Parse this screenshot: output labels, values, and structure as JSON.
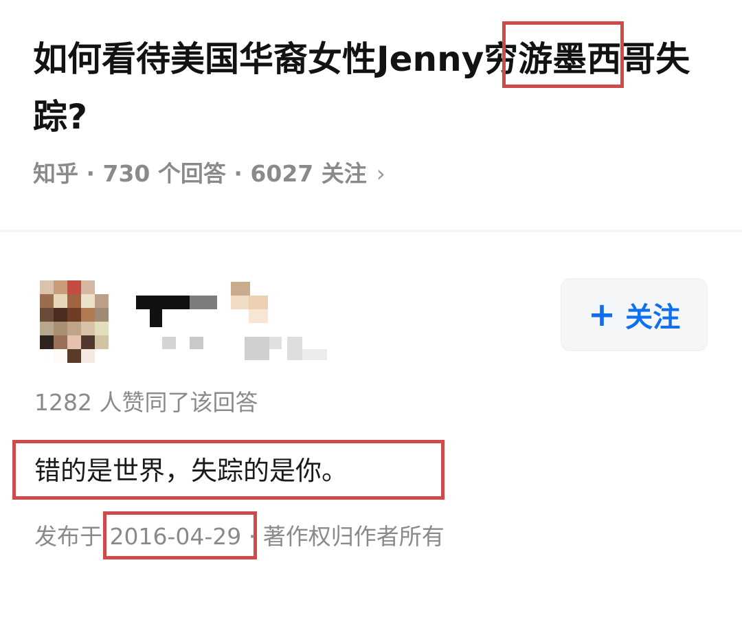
{
  "question": {
    "title": "如何看待美国华裔女性Jenny穷游墨西哥失踪?",
    "meta": "知乎 · 730 个回答 · 6027 关注",
    "chevron_icon": "chevron-right-icon"
  },
  "answer": {
    "author_avatar_icon": "pixelated-avatar",
    "author_name_icon": "pixelated-name",
    "follow_plus": "+",
    "follow_label": "关注",
    "votes": "1282 人赞同了该回答",
    "text": "错的是世界，失踪的是你。",
    "published": "发布于 2016-04-29 · 著作权归作者所有"
  },
  "colors": {
    "accent": "#0f6ff0",
    "highlight": "#cf4a4a",
    "muted_text": "#8a8a8a"
  }
}
